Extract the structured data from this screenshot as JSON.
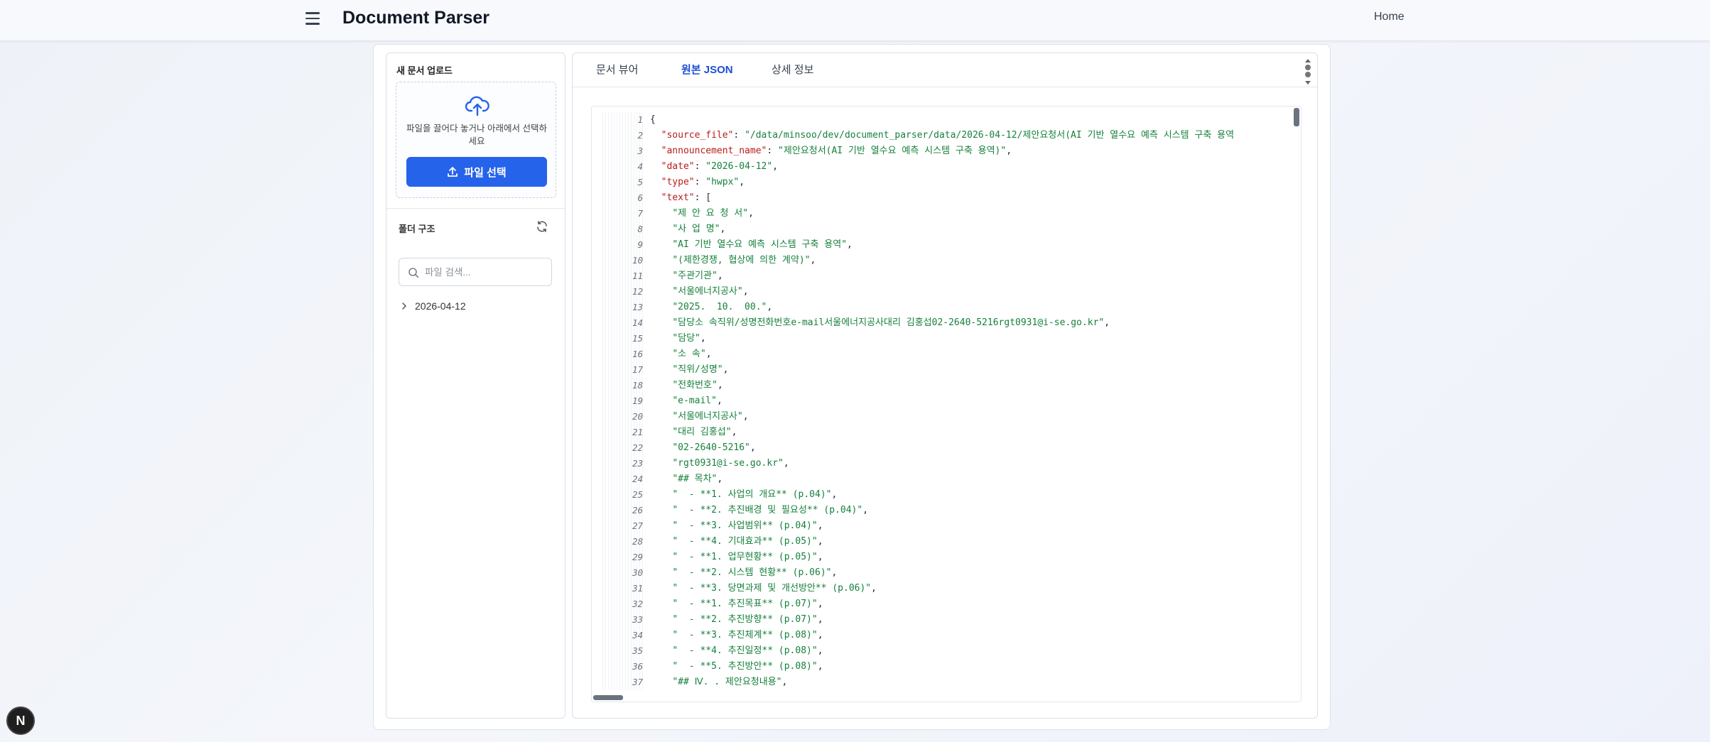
{
  "header": {
    "menu_icon": "hamburger-menu-icon",
    "title": "Document Parser",
    "home_label": "Home"
  },
  "upload": {
    "title": "새 문서 업로드",
    "drop_text": "파일을 끌어다 놓거나 아래에서 선택하세요",
    "button_label": "파일 선택",
    "icon": "cloud-upload-icon",
    "button_color": "#2563eb"
  },
  "folder": {
    "title": "폴더 구조",
    "search_placeholder": "파일 검색...",
    "tree": [
      {
        "label": "2026-04-12",
        "expanded": false
      }
    ]
  },
  "tabs": [
    {
      "label": "문서 뷰어",
      "active": false
    },
    {
      "label": "원본 JSON",
      "active": true
    },
    {
      "label": "상세 정보",
      "active": false
    }
  ],
  "code_lines": [
    {
      "n": "1",
      "parts": [
        [
          "p",
          "{"
        ]
      ]
    },
    {
      "n": "2",
      "parts": [
        [
          "p",
          "  "
        ],
        [
          "k",
          "\"source_file\""
        ],
        [
          "p",
          ": "
        ],
        [
          "s",
          "\"/data/minsoo/dev/document_parser/data/2026-04-12/제안요청서(AI 기반 열수요 예측 시스템 구축 용역"
        ]
      ]
    },
    {
      "n": "3",
      "parts": [
        [
          "p",
          "  "
        ],
        [
          "k",
          "\"announcement_name\""
        ],
        [
          "p",
          ": "
        ],
        [
          "s",
          "\"제안요청서(AI 기반 열수요 예측 시스템 구축 용역)\""
        ],
        [
          "p",
          ","
        ]
      ]
    },
    {
      "n": "4",
      "parts": [
        [
          "p",
          "  "
        ],
        [
          "k",
          "\"date\""
        ],
        [
          "p",
          ": "
        ],
        [
          "s",
          "\"2026-04-12\""
        ],
        [
          "p",
          ","
        ]
      ]
    },
    {
      "n": "5",
      "parts": [
        [
          "p",
          "  "
        ],
        [
          "k",
          "\"type\""
        ],
        [
          "p",
          ": "
        ],
        [
          "s",
          "\"hwpx\""
        ],
        [
          "p",
          ","
        ]
      ]
    },
    {
      "n": "6",
      "parts": [
        [
          "p",
          "  "
        ],
        [
          "k",
          "\"text\""
        ],
        [
          "p",
          ": ["
        ]
      ]
    },
    {
      "n": "7",
      "parts": [
        [
          "p",
          "    "
        ],
        [
          "s",
          "\"제 안 요 청 서\""
        ],
        [
          "p",
          ","
        ]
      ]
    },
    {
      "n": "8",
      "parts": [
        [
          "p",
          "    "
        ],
        [
          "s",
          "\"사 업 명\""
        ],
        [
          "p",
          ","
        ]
      ]
    },
    {
      "n": "9",
      "parts": [
        [
          "p",
          "    "
        ],
        [
          "s",
          "\"AI 기반 열수요 예측 시스템 구축 용역\""
        ],
        [
          "p",
          ","
        ]
      ]
    },
    {
      "n": "10",
      "parts": [
        [
          "p",
          "    "
        ],
        [
          "s",
          "\"(제한경쟁, 협상에 의한 계약)\""
        ],
        [
          "p",
          ","
        ]
      ]
    },
    {
      "n": "11",
      "parts": [
        [
          "p",
          "    "
        ],
        [
          "s",
          "\"주관기관\""
        ],
        [
          "p",
          ","
        ]
      ]
    },
    {
      "n": "12",
      "parts": [
        [
          "p",
          "    "
        ],
        [
          "s",
          "\"서울에너지공사\""
        ],
        [
          "p",
          ","
        ]
      ]
    },
    {
      "n": "13",
      "parts": [
        [
          "p",
          "    "
        ],
        [
          "s",
          "\"2025.  10.  00.\""
        ],
        [
          "p",
          ","
        ]
      ]
    },
    {
      "n": "14",
      "parts": [
        [
          "p",
          "    "
        ],
        [
          "s",
          "\"담당소 속직위/성명전화번호e-mail서울에너지공사대리 김홍섭02-2640-5216rgt0931@i-se.go.kr\""
        ],
        [
          "p",
          ","
        ]
      ]
    },
    {
      "n": "15",
      "parts": [
        [
          "p",
          "    "
        ],
        [
          "s",
          "\"담당\""
        ],
        [
          "p",
          ","
        ]
      ]
    },
    {
      "n": "16",
      "parts": [
        [
          "p",
          "    "
        ],
        [
          "s",
          "\"소 속\""
        ],
        [
          "p",
          ","
        ]
      ]
    },
    {
      "n": "17",
      "parts": [
        [
          "p",
          "    "
        ],
        [
          "s",
          "\"직위/성명\""
        ],
        [
          "p",
          ","
        ]
      ]
    },
    {
      "n": "18",
      "parts": [
        [
          "p",
          "    "
        ],
        [
          "s",
          "\"전화번호\""
        ],
        [
          "p",
          ","
        ]
      ]
    },
    {
      "n": "19",
      "parts": [
        [
          "p",
          "    "
        ],
        [
          "s",
          "\"e-mail\""
        ],
        [
          "p",
          ","
        ]
      ]
    },
    {
      "n": "20",
      "parts": [
        [
          "p",
          "    "
        ],
        [
          "s",
          "\"서울에너지공사\""
        ],
        [
          "p",
          ","
        ]
      ]
    },
    {
      "n": "21",
      "parts": [
        [
          "p",
          "    "
        ],
        [
          "s",
          "\"대리 김홍섭\""
        ],
        [
          "p",
          ","
        ]
      ]
    },
    {
      "n": "22",
      "parts": [
        [
          "p",
          "    "
        ],
        [
          "s",
          "\"02-2640-5216\""
        ],
        [
          "p",
          ","
        ]
      ]
    },
    {
      "n": "23",
      "parts": [
        [
          "p",
          "    "
        ],
        [
          "s",
          "\"rgt0931@i-se.go.kr\""
        ],
        [
          "p",
          ","
        ]
      ]
    },
    {
      "n": "24",
      "parts": [
        [
          "p",
          "    "
        ],
        [
          "s",
          "\"## 목차\""
        ],
        [
          "p",
          ","
        ]
      ]
    },
    {
      "n": "25",
      "parts": [
        [
          "p",
          "    "
        ],
        [
          "s",
          "\"  - **1. 사업의 개요** (p.04)\""
        ],
        [
          "p",
          ","
        ]
      ]
    },
    {
      "n": "26",
      "parts": [
        [
          "p",
          "    "
        ],
        [
          "s",
          "\"  - **2. 추진배경 및 필요성** (p.04)\""
        ],
        [
          "p",
          ","
        ]
      ]
    },
    {
      "n": "27",
      "parts": [
        [
          "p",
          "    "
        ],
        [
          "s",
          "\"  - **3. 사업범위** (p.04)\""
        ],
        [
          "p",
          ","
        ]
      ]
    },
    {
      "n": "28",
      "parts": [
        [
          "p",
          "    "
        ],
        [
          "s",
          "\"  - **4. 기대효과** (p.05)\""
        ],
        [
          "p",
          ","
        ]
      ]
    },
    {
      "n": "29",
      "parts": [
        [
          "p",
          "    "
        ],
        [
          "s",
          "\"  - **1. 업무현황** (p.05)\""
        ],
        [
          "p",
          ","
        ]
      ]
    },
    {
      "n": "30",
      "parts": [
        [
          "p",
          "    "
        ],
        [
          "s",
          "\"  - **2. 시스템 현황** (p.06)\""
        ],
        [
          "p",
          ","
        ]
      ]
    },
    {
      "n": "31",
      "parts": [
        [
          "p",
          "    "
        ],
        [
          "s",
          "\"  - **3. 당면과제 및 개선방안** (p.06)\""
        ],
        [
          "p",
          ","
        ]
      ]
    },
    {
      "n": "32",
      "parts": [
        [
          "p",
          "    "
        ],
        [
          "s",
          "\"  - **1. 추진목표** (p.07)\""
        ],
        [
          "p",
          ","
        ]
      ]
    },
    {
      "n": "33",
      "parts": [
        [
          "p",
          "    "
        ],
        [
          "s",
          "\"  - **2. 추진방향** (p.07)\""
        ],
        [
          "p",
          ","
        ]
      ]
    },
    {
      "n": "34",
      "parts": [
        [
          "p",
          "    "
        ],
        [
          "s",
          "\"  - **3. 추진체계** (p.08)\""
        ],
        [
          "p",
          ","
        ]
      ]
    },
    {
      "n": "35",
      "parts": [
        [
          "p",
          "    "
        ],
        [
          "s",
          "\"  - **4. 추진일정** (p.08)\""
        ],
        [
          "p",
          ","
        ]
      ]
    },
    {
      "n": "36",
      "parts": [
        [
          "p",
          "    "
        ],
        [
          "s",
          "\"  - **5. 추진방안** (p.08)\""
        ],
        [
          "p",
          ","
        ]
      ]
    },
    {
      "n": "37",
      "parts": [
        [
          "p",
          "    "
        ],
        [
          "s",
          "\"## Ⅳ. . 제안요청내용\""
        ],
        [
          "p",
          ","
        ]
      ]
    }
  ],
  "colors": {
    "key": "#b91c1c",
    "string": "#16803c",
    "accent": "#2563eb",
    "active_tab": "#1d4ed8"
  },
  "badge": {
    "label": "N"
  }
}
